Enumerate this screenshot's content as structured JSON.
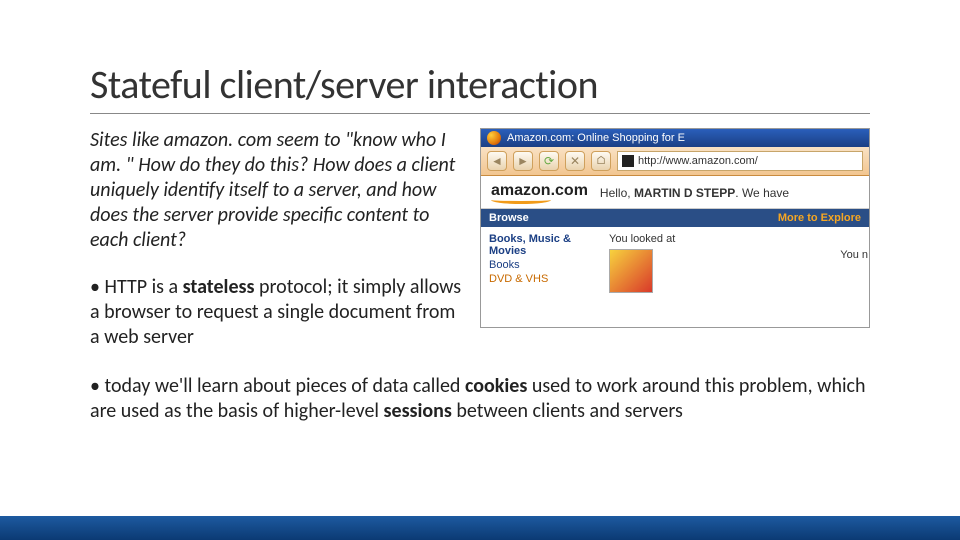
{
  "title": "Stateful client/server interaction",
  "intro": "Sites like amazon. com seem to \"know who I am. \" How do they do this? How does a client uniquely identify itself to a server, and how does the server provide specific content to each client?",
  "bullets": {
    "b1_pre": "• HTTP is a ",
    "b1_bold": "stateless",
    "b1_post": " protocol; it simply allows a browser to request a single document from a web server",
    "b2_pre": "• today we'll learn about pieces of data called ",
    "b2_bold1": "cookies",
    "b2_mid": " used to work around this problem, which are used as the basis of higher-level ",
    "b2_bold2": "sessions",
    "b2_post": " between clients and servers"
  },
  "screenshot": {
    "window_title": "Amazon.com: Online Shopping for E",
    "url": "http://www.amazon.com/",
    "logo_text": "amazon.com",
    "greeting_pre": "Hello, ",
    "greeting_name": "MARTIN D STEPP",
    "greeting_post": ". We have",
    "bluebar_left": "Browse",
    "bluebar_right": "More to Explore",
    "side_cat1": "Books, Music & Movies",
    "side_cat2": "Books",
    "side_cat3": "DVD & VHS",
    "looked": "You looked at",
    "you_n": "You n"
  }
}
